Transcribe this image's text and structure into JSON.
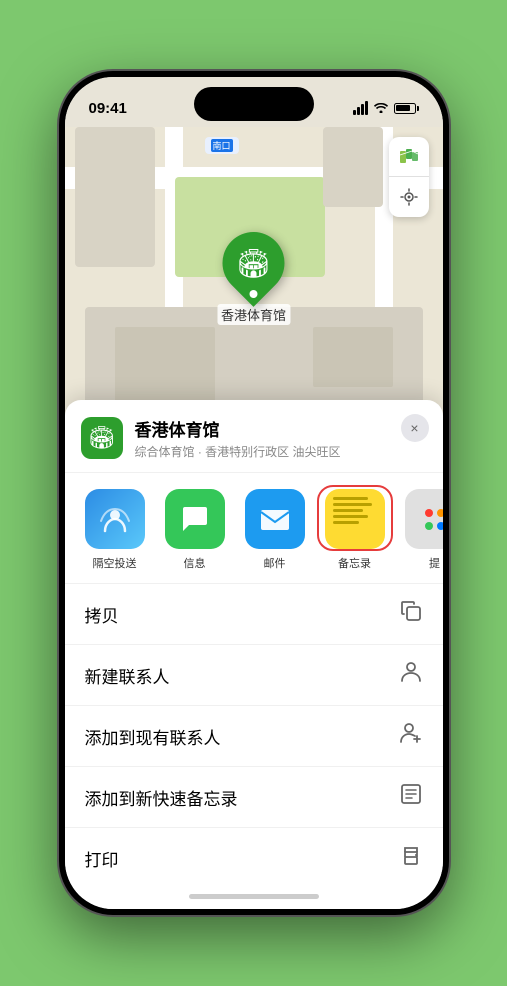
{
  "status_bar": {
    "time": "09:41",
    "location_arrow": "▶"
  },
  "map": {
    "label_text": "南口",
    "location_name": "香港体育馆",
    "pin_emoji": "🏟"
  },
  "map_controls": {
    "map_icon": "🗺",
    "location_icon": "➤"
  },
  "place_card": {
    "name": "香港体育馆",
    "subtitle": "综合体育馆 · 香港特别行政区 油尖旺区",
    "close_label": "×"
  },
  "share_items": [
    {
      "id": "airdrop",
      "label": "隔空投送",
      "type": "airdrop"
    },
    {
      "id": "messages",
      "label": "信息",
      "type": "messages"
    },
    {
      "id": "mail",
      "label": "邮件",
      "type": "mail"
    },
    {
      "id": "notes",
      "label": "备忘录",
      "type": "notes"
    }
  ],
  "action_rows": [
    {
      "id": "copy",
      "label": "拷贝",
      "icon": "copy"
    },
    {
      "id": "new-contact",
      "label": "新建联系人",
      "icon": "person"
    },
    {
      "id": "add-contact",
      "label": "添加到现有联系人",
      "icon": "person-add"
    },
    {
      "id": "quick-note",
      "label": "添加到新快速备忘录",
      "icon": "note"
    },
    {
      "id": "print",
      "label": "打印",
      "icon": "printer"
    }
  ]
}
